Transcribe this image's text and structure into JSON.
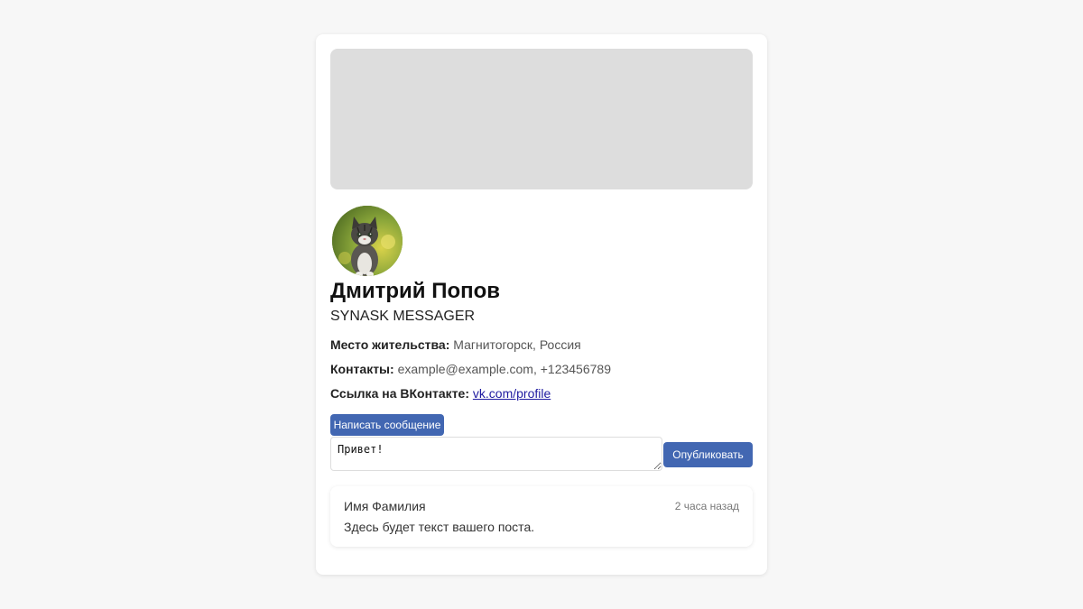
{
  "profile": {
    "name": "Дмитрий Попов",
    "subtitle": "SYNASK MESSAGER",
    "location_label": "Место жительства:",
    "location_value": "Магнитогорск, Россия",
    "contacts_label": "Контакты:",
    "contacts_value": "example@example.com, +123456789",
    "vk_label": "Ссылка на ВКонтакте:",
    "vk_link": "vk.com/profile"
  },
  "actions": {
    "message_button": "Написать сообщение",
    "publish_button": "Опубликовать",
    "composer_value": "Привет!"
  },
  "post": {
    "author": "Имя Фамилия",
    "time": "2 часа назад",
    "text": "Здесь будет текст вашего поста."
  },
  "colors": {
    "accent": "#4267b2",
    "cover": "#dddddd",
    "background": "#f7f7f7"
  }
}
